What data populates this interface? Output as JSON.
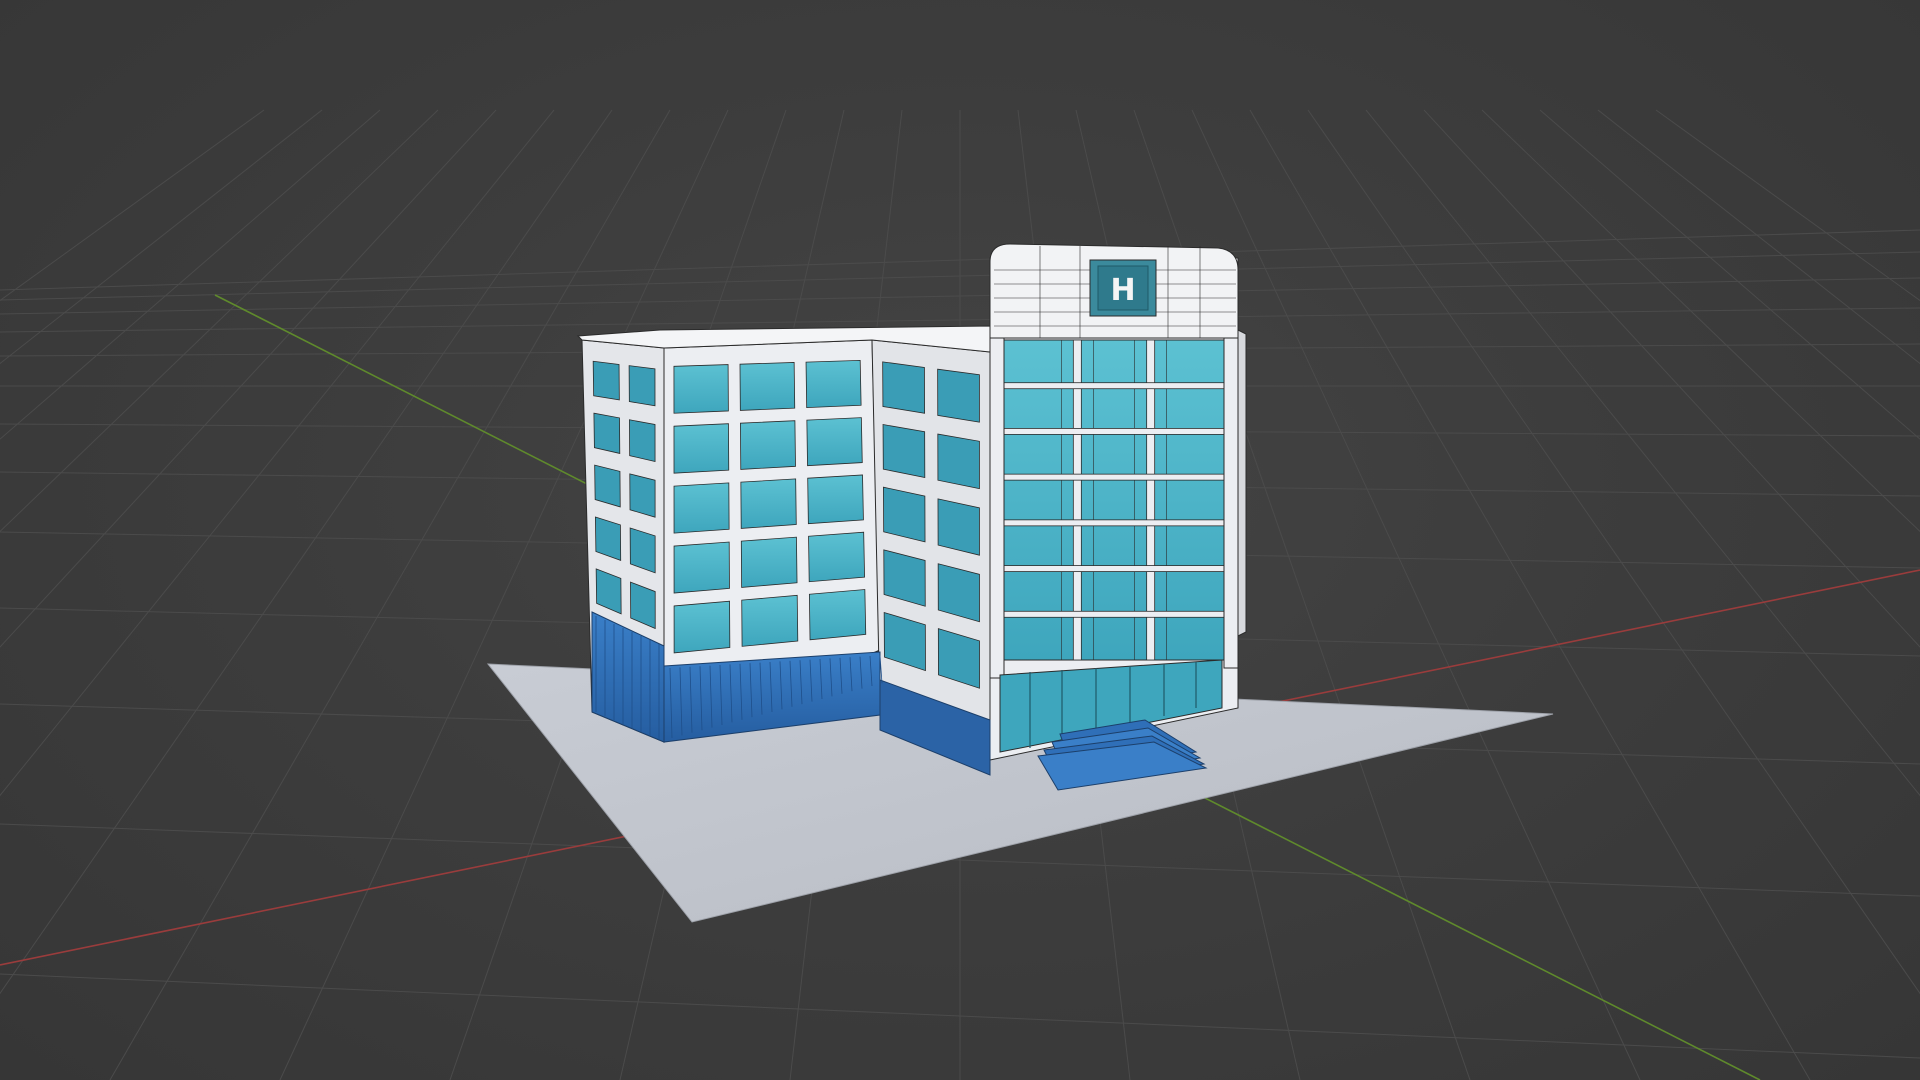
{
  "viewport": {
    "kind": "3d-viewport",
    "model": "hospital-building",
    "shading": "solid-with-wireframe"
  },
  "building": {
    "sign_text": "H"
  },
  "colors": {
    "background": "#3d3d3d",
    "grid_line": "#4a4a4a",
    "x_axis": "#9a3c3c",
    "y_axis": "#5f8a2c",
    "ground_plane": "#c2c6ce",
    "wall": "#eceef2",
    "glass": "#4fb4c8",
    "glass_dark": "#2f8ea6",
    "base": "#2f6fb8",
    "base_dark": "#245b99",
    "edge": "#2b2b2b"
  }
}
